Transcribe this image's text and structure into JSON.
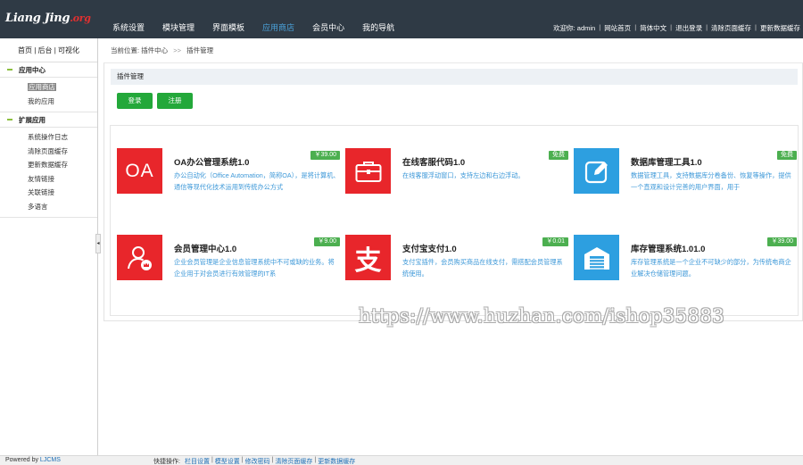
{
  "header": {
    "logo_text": "Liang Jing",
    "logo_suffix": ".org",
    "nav": [
      {
        "label": "系统设置",
        "active": false
      },
      {
        "label": "模块管理",
        "active": false
      },
      {
        "label": "界面模板",
        "active": false
      },
      {
        "label": "应用商店",
        "active": true
      },
      {
        "label": "会员中心",
        "active": false
      },
      {
        "label": "我的导航",
        "active": false
      }
    ],
    "userbar": {
      "welcome": "欢迎你: admin",
      "links": [
        "网站首页",
        "简体中文",
        "退出登录",
        "清除页面缓存",
        "更新数据缓存"
      ]
    }
  },
  "sidebar": {
    "quick_links": "首页 | 后台 | 可视化",
    "groups": [
      {
        "title": "应用中心",
        "items": [
          {
            "label": "应用商店",
            "current": true
          },
          {
            "label": "我的应用",
            "current": false
          }
        ]
      },
      {
        "title": "扩展应用",
        "items": [
          {
            "label": "系统操作日志"
          },
          {
            "label": "清除页面缓存"
          },
          {
            "label": "更新数据缓存"
          },
          {
            "label": "友情链接"
          },
          {
            "label": "关联链接"
          },
          {
            "label": "多语言"
          }
        ]
      }
    ],
    "collapse_glyph": "◂"
  },
  "breadcrumb": {
    "prefix": "当前位置:",
    "parent": "插件中心",
    "arrow": ">>",
    "current": "插件管理"
  },
  "panel": {
    "title": "插件管理",
    "login_label": "登录",
    "register_label": "注册"
  },
  "plugins": [
    {
      "title": "OA办公管理系统1.0",
      "price": "￥39.00",
      "desc": "办公自动化（Office Automation，简称OA），是将计算机、通信等现代化技术运用到传统办公方式",
      "thumb_color": "#e8262b",
      "icon": "oa-icon",
      "thumb_text": "OA"
    },
    {
      "title": "在线客服代码1.0",
      "price": "免费",
      "desc": "在线客服浮动窗口，支持左边和右边浮动。",
      "thumb_color": "#e8262b",
      "icon": "briefcase-icon"
    },
    {
      "title": "数据库管理工具1.0",
      "price": "免费",
      "desc": "数据管理工具，支持数据库分卷备份、恢复等操作，提供一个直观和设计完善的用户界面，用于",
      "thumb_color": "#2d9fe0",
      "icon": "edit-icon"
    },
    {
      "title": "会员管理中心1.0",
      "price": "￥9.00",
      "desc": "企业会员管理是企业信息管理系统中不可或缺的业务。将企业用于对会员进行有效管理的IT系",
      "thumb_color": "#e8262b",
      "icon": "member-icon"
    },
    {
      "title": "支付宝支付1.0",
      "price": "￥0.01",
      "desc": "支付宝插件，会员购买商品在线支付，需搭配会员管理系统使用。",
      "thumb_color": "#e8262b",
      "icon": "alipay-icon",
      "thumb_text": "支"
    },
    {
      "title": "库存管理系统1.01.0",
      "price": "￥39.00",
      "desc": "库存管理系统是一个企业不可缺少的部分，为传统电商企业解决仓储管理问题。",
      "thumb_color": "#2d9fe0",
      "icon": "warehouse-icon"
    }
  ],
  "watermark": "https://www.huzhan.com/ishop35883",
  "footer": {
    "powered_prefix": "Powered by",
    "powered_brand": "LJCMS",
    "quick_label": "快捷操作:",
    "quick_links": [
      "栏目设置",
      "模型设置",
      "修改密码",
      "清除页面缓存",
      "更新数据缓存"
    ]
  }
}
